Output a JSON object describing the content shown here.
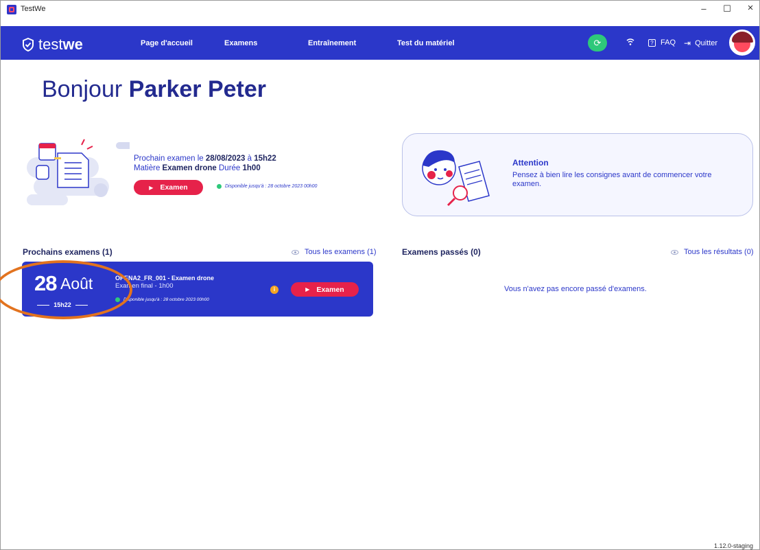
{
  "window": {
    "title": "TestWe",
    "minimize": "–",
    "maximize": "☐",
    "close": "×"
  },
  "nav": {
    "logo_light": "test",
    "logo_bold": "we",
    "links": [
      "Page d'accueil",
      "Examens",
      "Entraînement",
      "Test du matériel"
    ],
    "faq": "FAQ",
    "quit": "Quitter"
  },
  "greeting": {
    "prefix": "Bonjour ",
    "name": "Parker Peter"
  },
  "next_exam": {
    "line1_prefix": "Prochain examen le ",
    "date": "28/08/2023",
    "line1_mid": " à ",
    "time": "15h22",
    "line2_prefix": "Matière ",
    "subject": "Examen drone",
    "line2_mid": " Durée ",
    "duration": "1h00",
    "button": "Examen",
    "available": "Disponible jusqu'à : 28 octobre 2023 00h00"
  },
  "attention": {
    "title": "Attention",
    "text": "Pensez à bien lire les consignes avant de commencer votre examen."
  },
  "upcoming": {
    "title": "Prochains examens (1)",
    "link": "Tous les examens (1)",
    "card": {
      "day": "28",
      "month": "Août",
      "hour": "15h22",
      "code": "OPENA2_FR_001 - Examen drone",
      "sub": "Examen final - 1h00",
      "available": "Disponible jusqu'à : 28 octobre 2023 00h00",
      "button": "Examen"
    }
  },
  "past": {
    "title": "Examens passés (0)",
    "link": "Tous les résultats (0)",
    "empty": "Vous n'avez pas encore passé d'examens."
  },
  "version": "1.12.0-staging",
  "colors": {
    "brand": "#2b37c9",
    "accent_red": "#e6224a",
    "success": "#2ec87a",
    "annotation": "#e2731f"
  }
}
